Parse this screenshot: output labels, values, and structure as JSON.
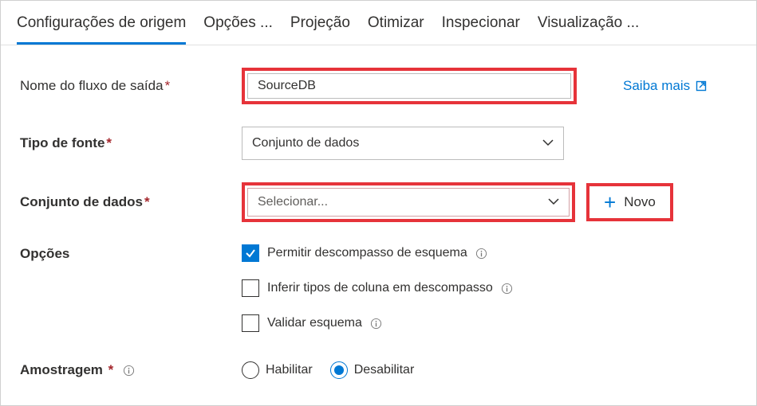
{
  "tabs": {
    "t0": "Configurações de origem",
    "t1": "Opções ...",
    "t2": "Projeção",
    "t3": "Otimizar",
    "t4": "Inspecionar",
    "t5": "Visualização ..."
  },
  "labels": {
    "outputStream": "Nome do fluxo de saída",
    "sourceType": "Tipo de fonte",
    "dataset": "Conjunto de dados",
    "options": "Opções",
    "sampling": "Amostragem"
  },
  "fields": {
    "outputStreamValue": "SourceDB",
    "sourceTypeValue": "Conjunto de dados",
    "datasetPlaceholder": "Selecionar..."
  },
  "links": {
    "learnMore": "Saiba mais",
    "new": "Novo"
  },
  "options": {
    "allowSchemaDrift": "Permitir descompasso de esquema",
    "inferDriftedTypes": "Inferir tipos de coluna em descompasso",
    "validateSchema": "Validar esquema"
  },
  "sampling": {
    "enable": "Habilitar",
    "disable": "Desabilitar"
  }
}
